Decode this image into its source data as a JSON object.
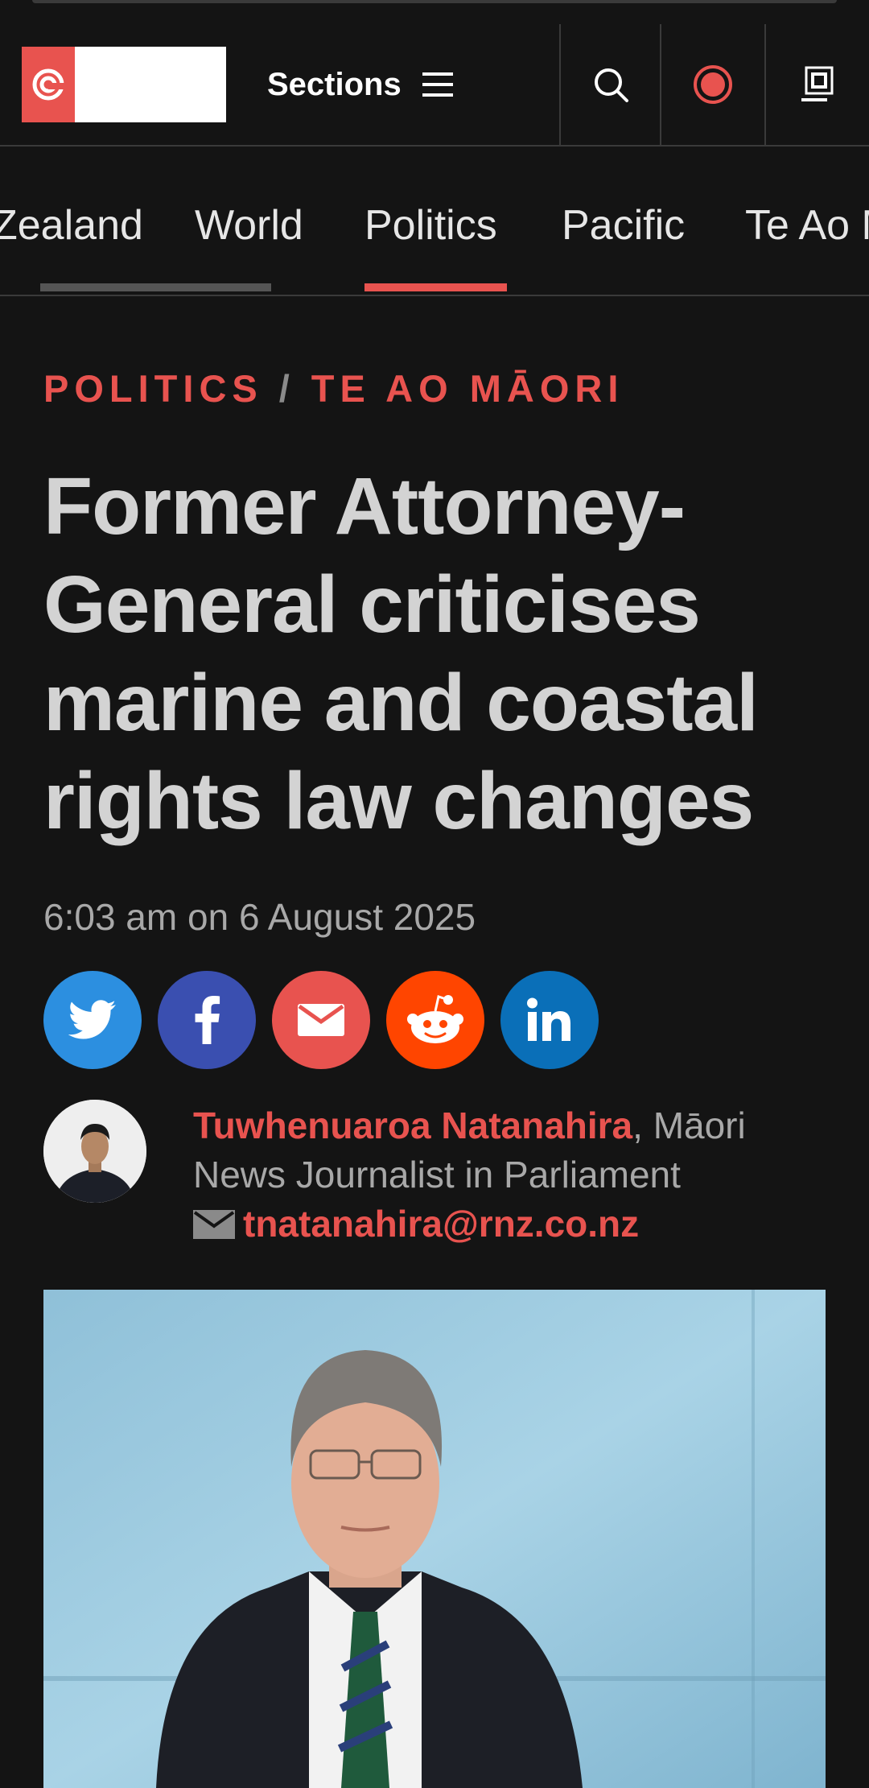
{
  "header": {
    "sections_label": "Sections"
  },
  "nav": {
    "tabs": [
      "Zealand",
      "World",
      "Politics",
      "Pacific",
      "Te Ao M"
    ],
    "active_tab": "Politics"
  },
  "article": {
    "kicker_primary": "POLITICS",
    "kicker_separator": "/",
    "kicker_secondary": "TE AO MĀORI",
    "headline": "Former Attorney-General criticises marine and coastal rights law changes",
    "date": "6:03 am on 6 August 2025",
    "share_icons": [
      "twitter-icon",
      "facebook-icon",
      "email-icon",
      "reddit-icon",
      "linkedin-icon"
    ],
    "author": {
      "name": "Tuwhenuaroa Natanahira",
      "role_suffix": ", Māori News Journalist in Parliament",
      "email": "tnatanahira@rnz.co.nz"
    }
  },
  "colors": {
    "accent": "#e8534f",
    "background": "#141414",
    "twitter": "#2c8fe0",
    "facebook": "#3a4fb0",
    "email": "#e8534f",
    "reddit": "#ff4500",
    "linkedin": "#0a6fb8"
  }
}
